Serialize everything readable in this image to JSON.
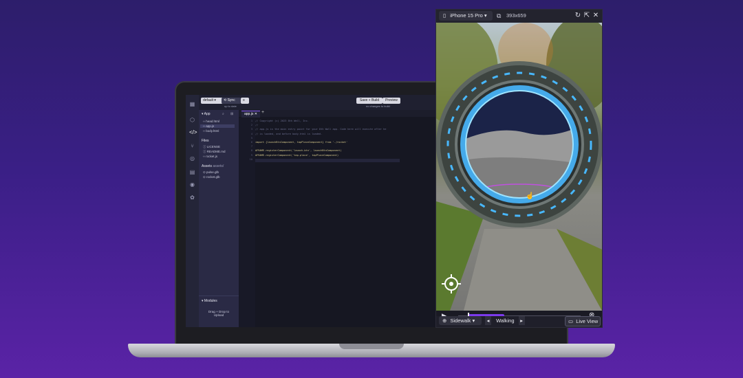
{
  "editor": {
    "branch": "default",
    "sync_label": "Sync",
    "sync_status": "up to date",
    "save_build_label": "Save + Build",
    "preview_label": "Preview",
    "build_status": "no changes to build",
    "active_tab": "app.js",
    "add_tab_symbol": "+",
    "panel_header": "App",
    "app_files": [
      "head.html",
      "app.js",
      "body.html"
    ],
    "files_header": "Files",
    "files": [
      "LICENSE",
      "README.md",
      "rocket.js"
    ],
    "assets_header": "Assets",
    "assets_sub": "assets/",
    "assets": [
      "pulse.glb",
      "rocket.glb"
    ],
    "modules_header": "Modules",
    "drop_hint": "Drag + Drop to Upload",
    "code_lines": [
      {
        "n": "1",
        "t": "// Copyright (c) 2023 8th Wall, Inc.",
        "k": "comment"
      },
      {
        "n": "2",
        "t": "//",
        "k": "comment"
      },
      {
        "n": "3",
        "t": "// app.js is the main entry point for your 8th Wall app. Code here will execute after he",
        "k": "comment"
      },
      {
        "n": "4",
        "t": "// is loaded, and before body.html is loaded.",
        "k": "comment"
      },
      {
        "n": "5",
        "t": "",
        "k": "code"
      },
      {
        "n": "6",
        "t": "import {launchBtnComponent, tapPlaceComponent} from './rocket'",
        "k": "code"
      },
      {
        "n": "7",
        "t": "",
        "k": "code"
      },
      {
        "n": "8",
        "t": "AFRAME.registerComponent('launch-btn', launchBtnComponent)",
        "k": "code"
      },
      {
        "n": "9",
        "t": "AFRAME.registerComponent('tap-place', tapPlaceComponent)",
        "k": "code"
      },
      {
        "n": "10",
        "t": "",
        "k": "code"
      }
    ]
  },
  "preview": {
    "device": "iPhone 15 Pro",
    "resolution": "393x659",
    "location": "Sidewalk",
    "activity": "Walking",
    "live_view_label": "Live View",
    "playback_progress": 0.3
  },
  "colors": {
    "background_top": "#2d1e6b",
    "background_bottom": "#5a23a6",
    "accent": "#8b5cf6",
    "portal_glow": "#48b8ff"
  }
}
